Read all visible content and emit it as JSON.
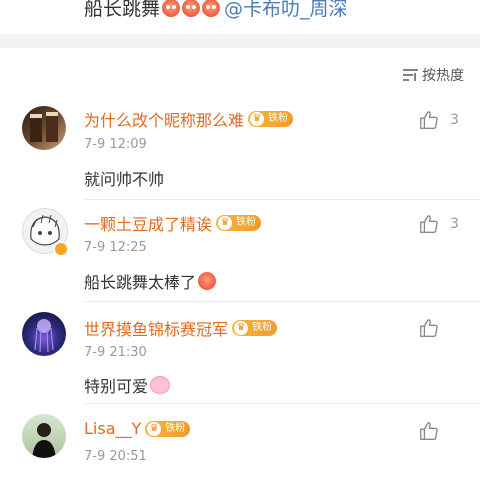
{
  "post": {
    "text_prefix": "船长跳舞",
    "mention": "@卡布叻_周深"
  },
  "sort": {
    "label": "按热度"
  },
  "comments": [
    {
      "name": "为什么改个昵称那么难",
      "badge": "铁粉",
      "time": "7-9 12:09",
      "text": "就问帅不帅",
      "likes": "3"
    },
    {
      "name": "一颗土豆成了精诶",
      "badge": "铁粉",
      "time": "7-9 12:25",
      "text": "船长跳舞太棒了",
      "likes": "3"
    },
    {
      "name": "世界摸鱼锦标赛冠军",
      "badge": "铁粉",
      "time": "7-9 21:30",
      "text": "特别可爱",
      "likes": ""
    },
    {
      "name": "Lisa__Y",
      "badge": "铁粉",
      "time": "7-9 20:51",
      "text": "",
      "likes": ""
    }
  ],
  "colors": {
    "username": "#e06a21",
    "mention": "#4a7cb3",
    "badge": "#f5b83d"
  }
}
